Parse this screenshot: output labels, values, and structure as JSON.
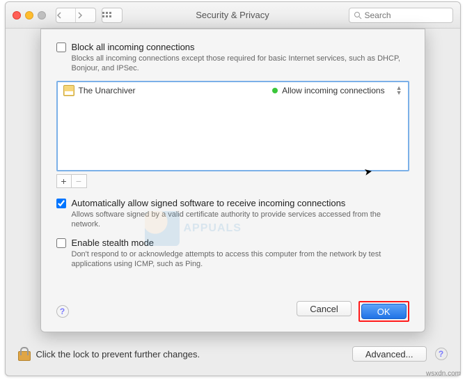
{
  "window": {
    "title": "Security & Privacy",
    "search_placeholder": "Search"
  },
  "sheet": {
    "block_all": {
      "checked": false,
      "label": "Block all incoming connections",
      "desc": "Blocks all incoming connections except those required for basic Internet services,  such as DHCP, Bonjour, and IPSec."
    },
    "apps": [
      {
        "name": "The Unarchiver",
        "status": "Allow incoming connections"
      }
    ],
    "auto_allow": {
      "checked": true,
      "label": "Automatically allow signed software to receive incoming connections",
      "desc": "Allows software signed by a valid certificate authority to provide services accessed from the network."
    },
    "stealth": {
      "checked": false,
      "label": "Enable stealth mode",
      "desc": "Don't respond to or acknowledge attempts to access this computer from the network by test applications using ICMP, such as Ping."
    },
    "buttons": {
      "cancel": "Cancel",
      "ok": "OK"
    },
    "add": "+",
    "remove": "−",
    "help": "?"
  },
  "bottom": {
    "lock_text": "Click the lock to prevent further changes.",
    "advanced": "Advanced...",
    "help": "?"
  },
  "watermark": "APPUALS",
  "credit": "wsxdn.com"
}
